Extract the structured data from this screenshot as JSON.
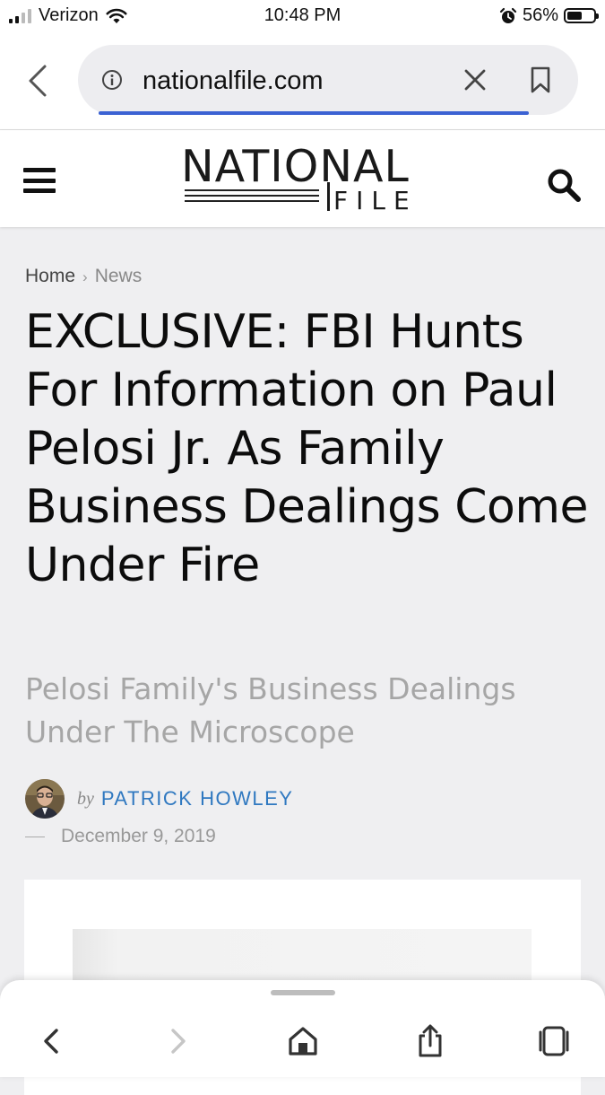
{
  "status_bar": {
    "carrier": "Verizon",
    "time": "10:48 PM",
    "battery_percent": "56%",
    "battery_level": 0.56,
    "signal_bars": 2,
    "icons": [
      "signal-icon",
      "wifi-icon",
      "alarm-icon",
      "battery-icon"
    ]
  },
  "browser": {
    "url": "nationalfile.com",
    "load_progress": 0.85,
    "icons": [
      "back-icon",
      "info-icon",
      "clear-icon",
      "bookmark-icon"
    ]
  },
  "site_header": {
    "logo_top": "NATIONAL",
    "logo_bottom": "FILE",
    "icons": [
      "menu-icon",
      "search-icon"
    ]
  },
  "breadcrumb": {
    "home": "Home",
    "separator": "›",
    "current": "News"
  },
  "article": {
    "headline": "EXCLUSIVE: FBI Hunts For Information on Paul Pelosi Jr. As Family Business Dealings Come Under Fire",
    "subhead": "Pelosi Family's Business Dealings Under The Microscope",
    "by_word": "by",
    "author": "PATRICK HOWLEY",
    "date": "December 9, 2019"
  },
  "toolbar": {
    "icons": [
      "back-icon",
      "forward-icon",
      "home-icon",
      "share-icon",
      "tabs-icon"
    ]
  },
  "colors": {
    "accent_link": "#2f78c0",
    "load_bar": "#3b62d3",
    "page_bg": "#efeff1"
  }
}
